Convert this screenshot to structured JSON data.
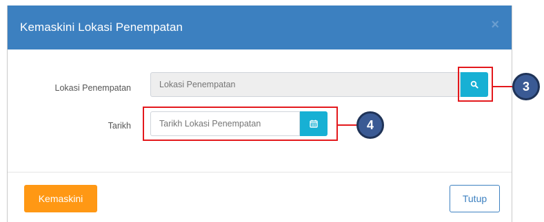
{
  "modal": {
    "title": "Kemaskini Lokasi Penempatan",
    "close_label": "×"
  },
  "form": {
    "location": {
      "label": "Lokasi Penempatan",
      "placeholder": "Lokasi Penempatan",
      "button_icon": "search-icon"
    },
    "date": {
      "label": "Tarikh",
      "placeholder": "Tarikh Lokasi Penempatan",
      "button_icon": "calendar-icon"
    }
  },
  "footer": {
    "update_label": "Kemaskini",
    "close_label": "Tutup"
  },
  "callouts": [
    "3",
    "4"
  ],
  "colors": {
    "header": "#3c80c0",
    "accent": "#17b0d4",
    "primary_button": "#ff9814",
    "highlight": "#e3171b",
    "callout": "#3a5a94"
  }
}
